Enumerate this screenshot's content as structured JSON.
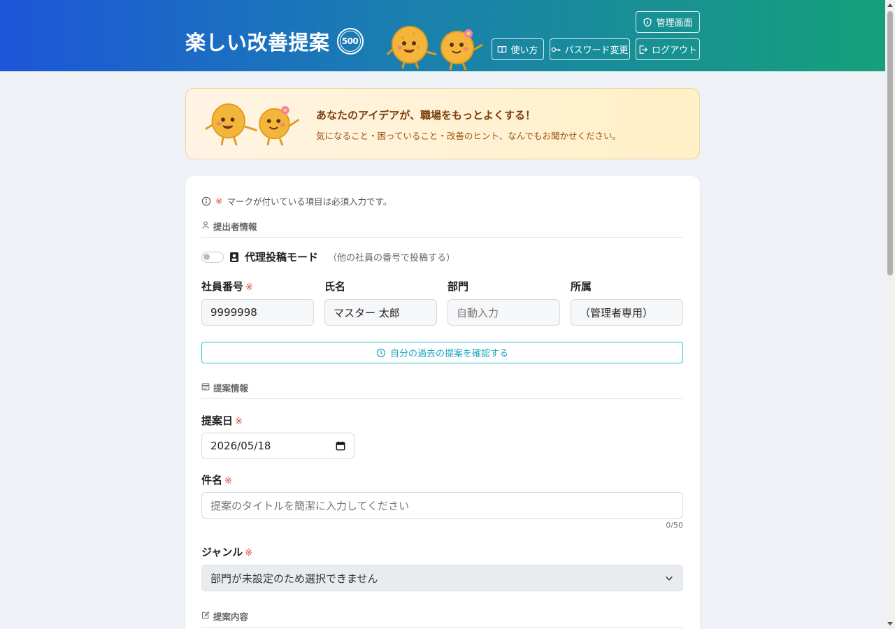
{
  "header": {
    "title": "楽しい改善提案",
    "badge": "500",
    "buttons": {
      "admin": "管理画面",
      "howto": "使い方",
      "password": "パスワード変更",
      "logout": "ログアウト"
    }
  },
  "banner": {
    "title": "あなたのアイデアが、職場をもっとよくする！",
    "subtitle": "気になること・困っていること・改善のヒント、なんでもお聞かせください。"
  },
  "form": {
    "required_note_mark": "※",
    "required_note": "マークが付いている項目は必須入力です。",
    "required_mark": "※",
    "sections": {
      "submitter": "提出者情報",
      "proposal_info": "提案情報",
      "proposal_content": "提案内容"
    },
    "proxy": {
      "label": "代理投稿モード",
      "hint": "（他の社員の番号で投稿する）"
    },
    "fields": {
      "employee_id": {
        "label": "社員番号",
        "value": "9999998"
      },
      "name": {
        "label": "氏名",
        "value": "マスター 太郎"
      },
      "department": {
        "label": "部門",
        "placeholder": "自動入力"
      },
      "affiliation": {
        "label": "所属",
        "value": "（管理者専用）"
      },
      "date": {
        "label": "提案日",
        "value": "2026/05/18"
      },
      "subject": {
        "label": "件名",
        "placeholder": "提案のタイトルを簡潔に入力してください",
        "count": "0/50"
      },
      "genre": {
        "label": "ジャンル",
        "value": "部門が未設定のため選択できません"
      }
    },
    "history_button": "自分の過去の提案を確認する"
  },
  "colors": {
    "header_start": "#1d56d9",
    "header_end": "#16a07a",
    "required": "#e0443c",
    "history_accent": "#18a7bf"
  }
}
